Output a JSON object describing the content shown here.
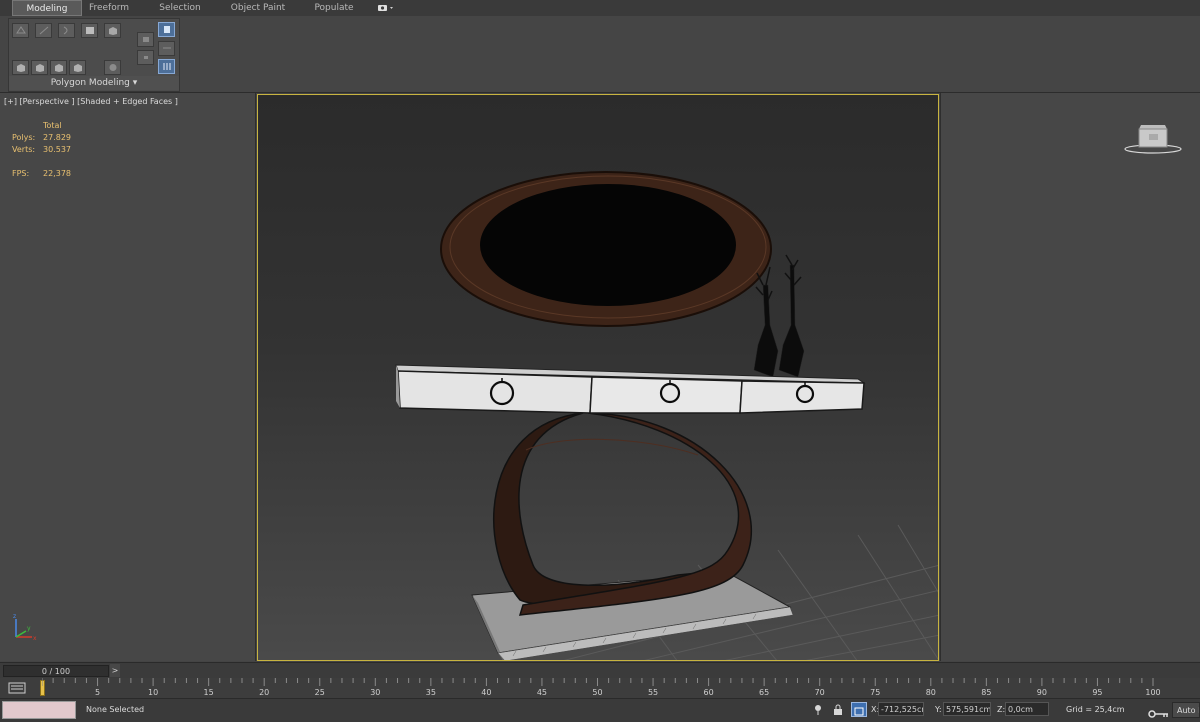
{
  "ribbon": {
    "tabs": [
      {
        "label": "Modeling",
        "active": true
      },
      {
        "label": "Freeform",
        "active": false
      },
      {
        "label": "Selection",
        "active": false
      },
      {
        "label": "Object Paint",
        "active": false
      },
      {
        "label": "Populate",
        "active": false
      }
    ],
    "group_label": "Polygon Modeling",
    "dropdown_glyph": "▾"
  },
  "viewport": {
    "label": "[+] [Perspective ] [Shaded + Edged Faces ]",
    "stats": {
      "total_label": "Total",
      "polys_label": "Polys:",
      "polys_value": "27.829",
      "verts_label": "Verts:",
      "verts_value": "30.537",
      "fps_label": "FPS:",
      "fps_value": "22,378"
    },
    "viewcube_icon": "viewcube-icon",
    "axis_labels": {
      "x": "x",
      "y": "y",
      "z": "z"
    }
  },
  "timeline": {
    "frame_display": "0 / 100",
    "next_arrow": ">",
    "ticks": [
      "5",
      "10",
      "15",
      "20",
      "25",
      "30",
      "35",
      "40",
      "45",
      "50",
      "55",
      "60",
      "65",
      "70",
      "75",
      "80",
      "85",
      "90",
      "95",
      "100"
    ]
  },
  "status_bar": {
    "selection": "None Selected",
    "x_label": "X:",
    "x_value": "-712,525cm",
    "y_label": "Y:",
    "y_value": "575,591cm",
    "z_label": "Z:",
    "z_value": "0,0cm",
    "grid": "Grid = 25,4cm",
    "auto_key": "Auto Key"
  },
  "colors": {
    "accent": "#c8b440",
    "stats_text": "#e8c070",
    "wood": "#3a2218",
    "drawer_white": "#e6e6e6"
  }
}
